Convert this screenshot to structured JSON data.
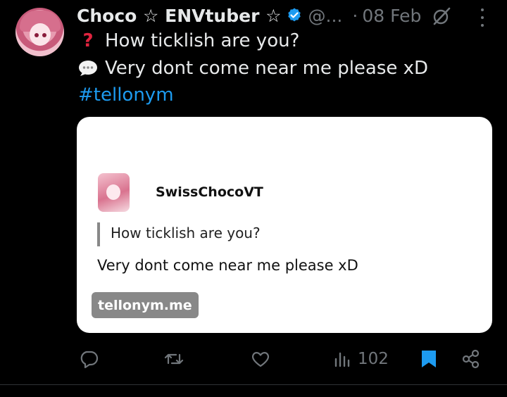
{
  "tweet": {
    "author_name": "Choco ☆ ENVtuber ☆",
    "handle": "@...",
    "separator": "·",
    "date": "08 Feb",
    "question_line": "How ticklish are you?",
    "answer_line": "Very dont come near me please xD",
    "hashtag": "#tellonym"
  },
  "card": {
    "username": "SwissChocoVT",
    "question": "How ticklish are you?",
    "answer": "Very dont come near me please xD",
    "site": "tellonym.me"
  },
  "actions": {
    "views": "102"
  },
  "colors": {
    "background": "#000000",
    "text": "#e7e9ea",
    "muted": "#71767b",
    "link": "#1d9bf0",
    "bookmark": "#1d9bf0",
    "verified": "#1d9bf0"
  },
  "icons": [
    "verified-badge-icon",
    "grok-icon",
    "more-icon",
    "question-mark-icon",
    "speech-bubble-icon",
    "reply-icon",
    "retweet-icon",
    "like-icon",
    "views-icon",
    "bookmark-icon",
    "share-icon"
  ]
}
